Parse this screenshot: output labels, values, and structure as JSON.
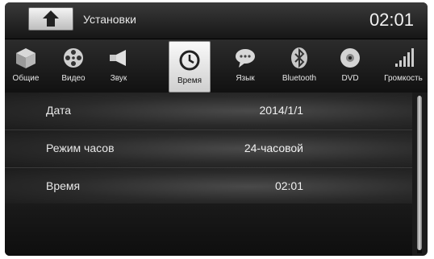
{
  "header": {
    "title": "Установки",
    "clock": "02:01"
  },
  "tabs": [
    {
      "label": "Общие",
      "icon": "cube-icon"
    },
    {
      "label": "Видео",
      "icon": "film-reel-icon"
    },
    {
      "label": "Звук",
      "icon": "speaker-icon"
    },
    {
      "label": "Время",
      "icon": "clock-icon",
      "active": true
    },
    {
      "label": "Язык",
      "icon": "speech-bubble-icon"
    },
    {
      "label": "Bluetooth",
      "icon": "bluetooth-icon"
    },
    {
      "label": "DVD",
      "icon": "disc-icon"
    },
    {
      "label": "Громкость",
      "icon": "volume-bars-icon"
    }
  ],
  "settings": [
    {
      "label": "Дата",
      "value": "2014/1/1"
    },
    {
      "label": "Режим часов",
      "value": "24-часовой"
    },
    {
      "label": "Время",
      "value": "02:01"
    }
  ],
  "colors": {
    "background": "#1b1b1b",
    "active_tab": "#e8e8e8",
    "text": "#e8e8e8"
  }
}
